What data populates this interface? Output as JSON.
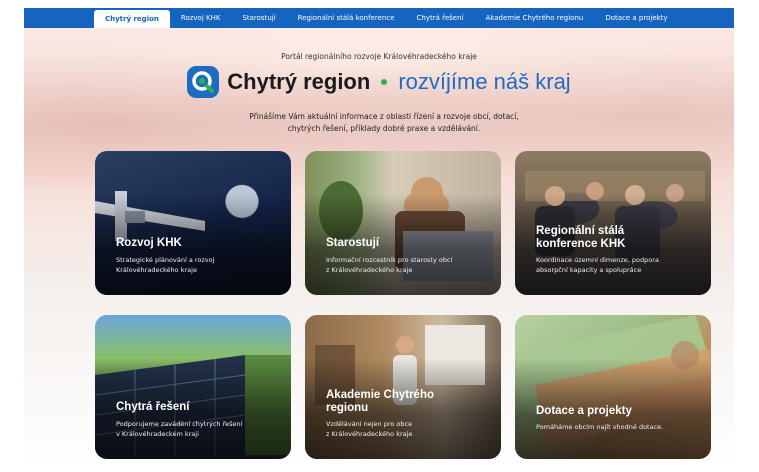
{
  "nav": {
    "items": [
      {
        "label": "Chytrý region",
        "active": true
      },
      {
        "label": "Rozvoj KHK",
        "active": false
      },
      {
        "label": "Starostují",
        "active": false
      },
      {
        "label": "Regionální stálá konference",
        "active": false
      },
      {
        "label": "Chytrá řešení",
        "active": false
      },
      {
        "label": "Akademie Chytrého regionu",
        "active": false
      },
      {
        "label": "Dotace a projekty",
        "active": false
      }
    ]
  },
  "hero": {
    "subtitle": "Portál regionálního rozvoje Královéhradeckého kraje",
    "brand": "Chytrý region",
    "tagline": "rozvíjíme náš kraj",
    "intro_line1": "Přinášíme Vám aktuální informace z oblasti řízení a rozvoje obcí, dotací,",
    "intro_line2": "chytrých řešení, příklady dobré praxe a vzdělávání.",
    "logo_icon": "search-logo-icon"
  },
  "colors": {
    "nav_bg": "#1565c0",
    "brand_blue": "#1e6bc4",
    "accent_green": "#2fb24c"
  },
  "cards": [
    {
      "title_line1": "Rozvoj KHK",
      "title_line2": "",
      "desc_line1": "Strategické plánování a rozvoj",
      "desc_line2": "Královéhradeckého kraje"
    },
    {
      "title_line1": "Starostují",
      "title_line2": "",
      "desc_line1": "Informační rozcestník pro starosty obcí",
      "desc_line2": "z Královéhradeckého kraje"
    },
    {
      "title_line1": "Regionální stálá",
      "title_line2": "konference KHK",
      "desc_line1": "Koordinace územní dimenze, podpora",
      "desc_line2": "absorpční kapacity a spolupráce"
    },
    {
      "title_line1": "Chytrá řešení",
      "title_line2": "",
      "desc_line1": "Podporujeme zavádění chytrých řešení",
      "desc_line2": "v Královéhradeckém kraji"
    },
    {
      "title_line1": "Akademie Chytrého",
      "title_line2": "regionu",
      "desc_line1": "Vzdělávání nejen pro obce",
      "desc_line2": "z Královéhradeckého kraje"
    },
    {
      "title_line1": "Dotace a projekty",
      "title_line2": "",
      "desc_line1": "Pomáháme obcím najít vhodné dotace.",
      "desc_line2": ""
    }
  ]
}
